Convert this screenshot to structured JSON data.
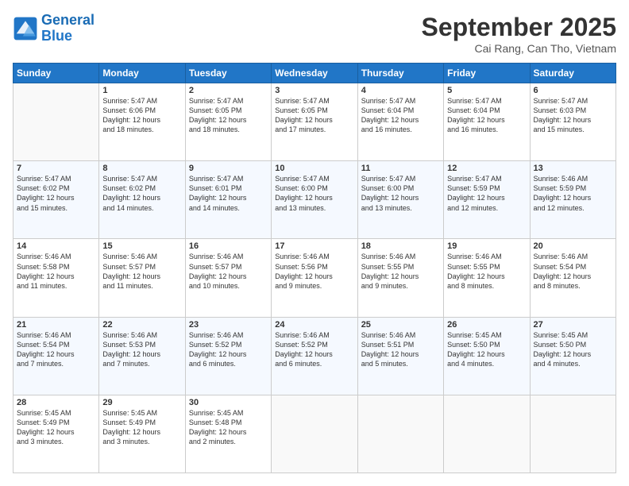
{
  "header": {
    "logo_line1": "General",
    "logo_line2": "Blue",
    "month": "September 2025",
    "location": "Cai Rang, Can Tho, Vietnam"
  },
  "weekdays": [
    "Sunday",
    "Monday",
    "Tuesday",
    "Wednesday",
    "Thursday",
    "Friday",
    "Saturday"
  ],
  "weeks": [
    [
      {
        "day": "",
        "info": ""
      },
      {
        "day": "1",
        "info": "Sunrise: 5:47 AM\nSunset: 6:06 PM\nDaylight: 12 hours\nand 18 minutes."
      },
      {
        "day": "2",
        "info": "Sunrise: 5:47 AM\nSunset: 6:05 PM\nDaylight: 12 hours\nand 18 minutes."
      },
      {
        "day": "3",
        "info": "Sunrise: 5:47 AM\nSunset: 6:05 PM\nDaylight: 12 hours\nand 17 minutes."
      },
      {
        "day": "4",
        "info": "Sunrise: 5:47 AM\nSunset: 6:04 PM\nDaylight: 12 hours\nand 16 minutes."
      },
      {
        "day": "5",
        "info": "Sunrise: 5:47 AM\nSunset: 6:04 PM\nDaylight: 12 hours\nand 16 minutes."
      },
      {
        "day": "6",
        "info": "Sunrise: 5:47 AM\nSunset: 6:03 PM\nDaylight: 12 hours\nand 15 minutes."
      }
    ],
    [
      {
        "day": "7",
        "info": "Sunrise: 5:47 AM\nSunset: 6:02 PM\nDaylight: 12 hours\nand 15 minutes."
      },
      {
        "day": "8",
        "info": "Sunrise: 5:47 AM\nSunset: 6:02 PM\nDaylight: 12 hours\nand 14 minutes."
      },
      {
        "day": "9",
        "info": "Sunrise: 5:47 AM\nSunset: 6:01 PM\nDaylight: 12 hours\nand 14 minutes."
      },
      {
        "day": "10",
        "info": "Sunrise: 5:47 AM\nSunset: 6:00 PM\nDaylight: 12 hours\nand 13 minutes."
      },
      {
        "day": "11",
        "info": "Sunrise: 5:47 AM\nSunset: 6:00 PM\nDaylight: 12 hours\nand 13 minutes."
      },
      {
        "day": "12",
        "info": "Sunrise: 5:47 AM\nSunset: 5:59 PM\nDaylight: 12 hours\nand 12 minutes."
      },
      {
        "day": "13",
        "info": "Sunrise: 5:46 AM\nSunset: 5:59 PM\nDaylight: 12 hours\nand 12 minutes."
      }
    ],
    [
      {
        "day": "14",
        "info": "Sunrise: 5:46 AM\nSunset: 5:58 PM\nDaylight: 12 hours\nand 11 minutes."
      },
      {
        "day": "15",
        "info": "Sunrise: 5:46 AM\nSunset: 5:57 PM\nDaylight: 12 hours\nand 11 minutes."
      },
      {
        "day": "16",
        "info": "Sunrise: 5:46 AM\nSunset: 5:57 PM\nDaylight: 12 hours\nand 10 minutes."
      },
      {
        "day": "17",
        "info": "Sunrise: 5:46 AM\nSunset: 5:56 PM\nDaylight: 12 hours\nand 9 minutes."
      },
      {
        "day": "18",
        "info": "Sunrise: 5:46 AM\nSunset: 5:55 PM\nDaylight: 12 hours\nand 9 minutes."
      },
      {
        "day": "19",
        "info": "Sunrise: 5:46 AM\nSunset: 5:55 PM\nDaylight: 12 hours\nand 8 minutes."
      },
      {
        "day": "20",
        "info": "Sunrise: 5:46 AM\nSunset: 5:54 PM\nDaylight: 12 hours\nand 8 minutes."
      }
    ],
    [
      {
        "day": "21",
        "info": "Sunrise: 5:46 AM\nSunset: 5:54 PM\nDaylight: 12 hours\nand 7 minutes."
      },
      {
        "day": "22",
        "info": "Sunrise: 5:46 AM\nSunset: 5:53 PM\nDaylight: 12 hours\nand 7 minutes."
      },
      {
        "day": "23",
        "info": "Sunrise: 5:46 AM\nSunset: 5:52 PM\nDaylight: 12 hours\nand 6 minutes."
      },
      {
        "day": "24",
        "info": "Sunrise: 5:46 AM\nSunset: 5:52 PM\nDaylight: 12 hours\nand 6 minutes."
      },
      {
        "day": "25",
        "info": "Sunrise: 5:46 AM\nSunset: 5:51 PM\nDaylight: 12 hours\nand 5 minutes."
      },
      {
        "day": "26",
        "info": "Sunrise: 5:45 AM\nSunset: 5:50 PM\nDaylight: 12 hours\nand 4 minutes."
      },
      {
        "day": "27",
        "info": "Sunrise: 5:45 AM\nSunset: 5:50 PM\nDaylight: 12 hours\nand 4 minutes."
      }
    ],
    [
      {
        "day": "28",
        "info": "Sunrise: 5:45 AM\nSunset: 5:49 PM\nDaylight: 12 hours\nand 3 minutes."
      },
      {
        "day": "29",
        "info": "Sunrise: 5:45 AM\nSunset: 5:49 PM\nDaylight: 12 hours\nand 3 minutes."
      },
      {
        "day": "30",
        "info": "Sunrise: 5:45 AM\nSunset: 5:48 PM\nDaylight: 12 hours\nand 2 minutes."
      },
      {
        "day": "",
        "info": ""
      },
      {
        "day": "",
        "info": ""
      },
      {
        "day": "",
        "info": ""
      },
      {
        "day": "",
        "info": ""
      }
    ]
  ]
}
